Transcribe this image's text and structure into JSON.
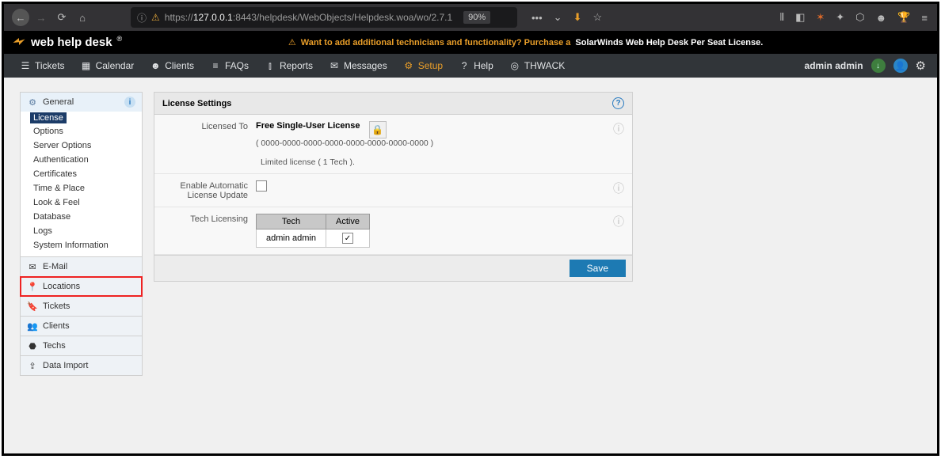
{
  "browser": {
    "url_prefix": "https://",
    "url_host": "127.0.0.1",
    "url_port_path": ":8443/helpdesk/WebObjects/Helpdesk.woa/wo/2.7.1",
    "zoom": "90%"
  },
  "app": {
    "logo_text": "web help desk",
    "banner_lead": "Want to add additional technicians and functionality? Purchase a",
    "banner_link": "SolarWinds Web Help Desk Per Seat License."
  },
  "nav": {
    "tickets": "Tickets",
    "calendar": "Calendar",
    "clients": "Clients",
    "faqs": "FAQs",
    "reports": "Reports",
    "messages": "Messages",
    "setup": "Setup",
    "help": "Help",
    "thwack": "THWACK",
    "user": "admin admin"
  },
  "sidebar": {
    "general": "General",
    "general_items": [
      "License",
      "Options",
      "Server Options",
      "Authentication",
      "Certificates",
      "Time & Place",
      "Look & Feel",
      "Database",
      "Logs",
      "System Information"
    ],
    "email": "E-Mail",
    "locations": "Locations",
    "tickets": "Tickets",
    "clients": "Clients",
    "techs": "Techs",
    "dataimport": "Data Import"
  },
  "panel": {
    "title": "License Settings",
    "licensed_to_label": "Licensed To",
    "license_name": "Free Single-User License",
    "license_key": "( 0000-0000-0000-0000-0000-0000-0000-0000 )",
    "license_note": "Limited license ( 1 Tech ).",
    "auto_update_label": "Enable Automatic License Update",
    "tech_licensing_label": "Tech Licensing",
    "th_tech": "Tech",
    "th_active": "Active",
    "tech_name": "admin admin",
    "save": "Save"
  }
}
